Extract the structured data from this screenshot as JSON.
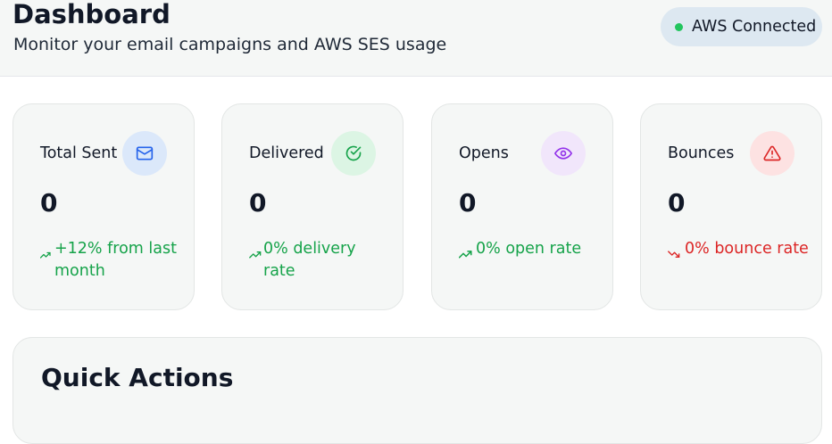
{
  "header": {
    "title": "Dashboard",
    "subtitle": "Monitor your email campaigns and AWS SES usage",
    "status_badge": "AWS Connected",
    "status_color": "#22c55e"
  },
  "stats": [
    {
      "title": "Total Sent",
      "value": "0",
      "trend": "+12% from last month",
      "direction": "up",
      "icon": "mail-icon",
      "icon_bg": "#dbe8fa",
      "icon_color": "#2563eb"
    },
    {
      "title": "Delivered",
      "value": "0",
      "trend": "0% delivery rate",
      "direction": "up",
      "icon": "check-circle-icon",
      "icon_bg": "#dcf5e4",
      "icon_color": "#16a34a"
    },
    {
      "title": "Opens",
      "value": "0",
      "trend": "0% open rate",
      "direction": "up",
      "icon": "eye-icon",
      "icon_bg": "#f1e6fb",
      "icon_color": "#9333ea"
    },
    {
      "title": "Bounces",
      "value": "0",
      "trend": "0% bounce rate",
      "direction": "down",
      "icon": "alert-triangle-icon",
      "icon_bg": "#fde2e2",
      "icon_color": "#dc2626"
    }
  ],
  "quick_actions": {
    "title": "Quick Actions"
  }
}
